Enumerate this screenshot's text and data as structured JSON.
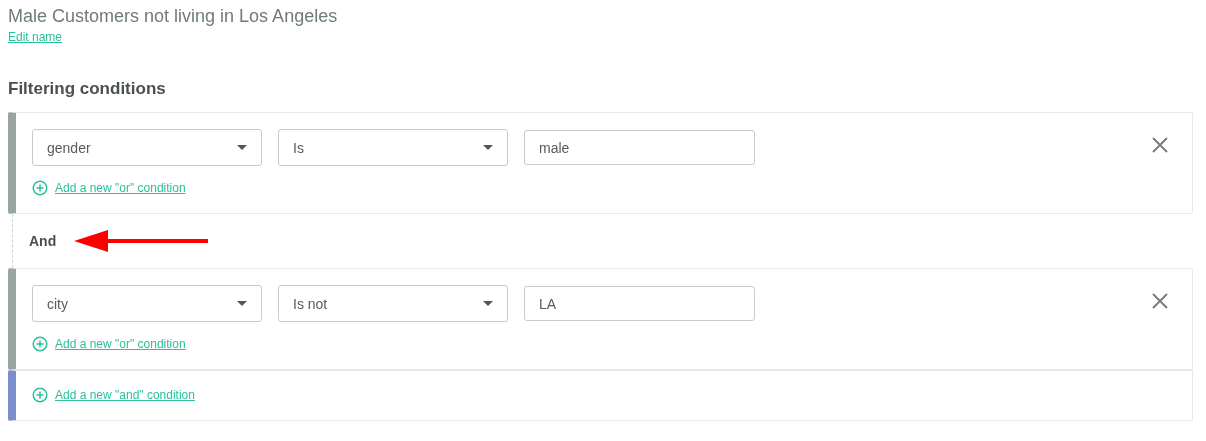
{
  "title": "Male Customers not living in Los Angeles",
  "edit_link": "Edit name",
  "heading": "Filtering conditions",
  "groups": [
    {
      "field": "gender",
      "operator": "Is",
      "value": "male",
      "add_or": "Add a new \"or\" condition"
    },
    {
      "field": "city",
      "operator": "Is not",
      "value": "LA",
      "add_or": "Add a new \"or\" condition"
    }
  ],
  "connector": "And",
  "add_and": "Add a new \"and\" condition"
}
